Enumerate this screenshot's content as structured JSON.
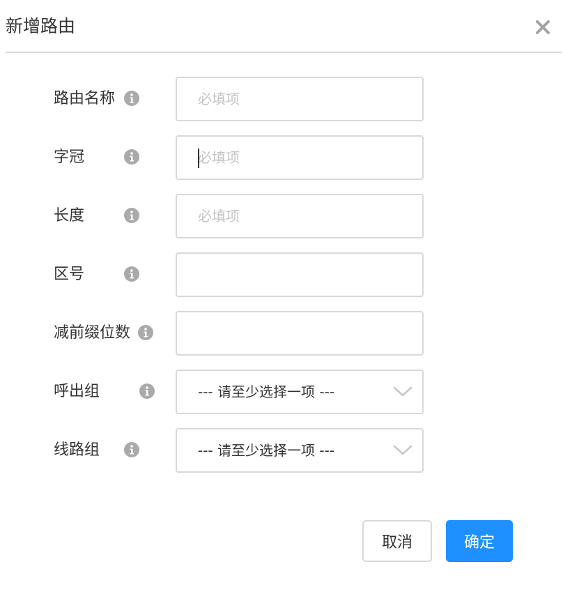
{
  "dialog": {
    "title": "新增路由"
  },
  "form": {
    "route_name": {
      "label": "路由名称",
      "placeholder": "必填项",
      "value": ""
    },
    "prefix": {
      "label": "字冠",
      "placeholder": "必填项",
      "value": ""
    },
    "length": {
      "label": "长度",
      "placeholder": "必填项",
      "value": ""
    },
    "area_code": {
      "label": "区号",
      "placeholder": "",
      "value": ""
    },
    "strip_digits": {
      "label": "减前缀位数",
      "placeholder": "",
      "value": ""
    },
    "outbound_group": {
      "label": "呼出组",
      "selected": "--- 请至少选择一项 ---"
    },
    "trunk_group": {
      "label": "线路组",
      "selected": "--- 请至少选择一项 ---"
    }
  },
  "buttons": {
    "cancel_label": "取消",
    "confirm_label": "确定"
  },
  "colors": {
    "primary": "#1e90ff",
    "border": "#d9d9d9",
    "text": "#333333",
    "placeholder": "#c4c4c4",
    "icon_gray": "#aaaaaa"
  },
  "icons": {
    "close": "close-icon",
    "info": "info-icon",
    "dropdown": "chevron-down-icon"
  }
}
